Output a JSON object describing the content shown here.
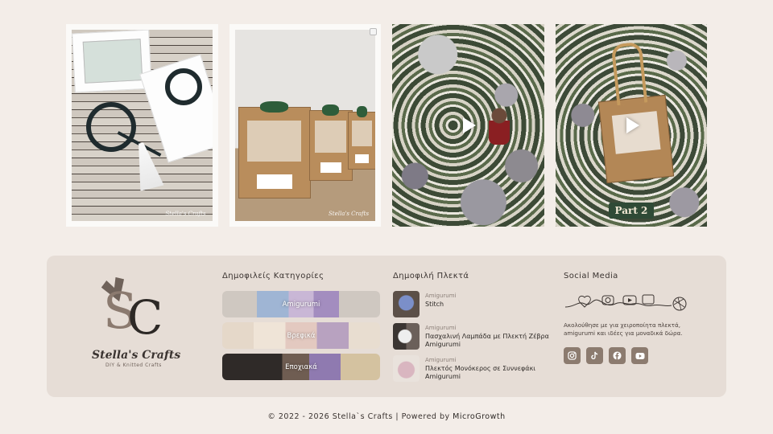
{
  "instagram": {
    "posts": [
      {
        "type": "image",
        "watermark": "Stella's Crafts"
      },
      {
        "type": "carousel",
        "watermark": "Stella's Crafts"
      },
      {
        "type": "video"
      },
      {
        "type": "video",
        "overlay_text": "Part 2"
      }
    ]
  },
  "brand": {
    "name": "Stella's Crafts",
    "tagline": "DIY & Knitted Crafts",
    "monogram_first": "S",
    "monogram_second": "C"
  },
  "categories": {
    "title": "Δημοφιλείς Κατηγορίες",
    "items": [
      {
        "label": "Amigurumi"
      },
      {
        "label": "Βρεφικά"
      },
      {
        "label": "Εποχιακά"
      }
    ]
  },
  "products": {
    "title": "Δημοφιλή Πλεκτά",
    "items": [
      {
        "category": "Amigurumi",
        "name": "Stitch"
      },
      {
        "category": "Amigurumi",
        "name": "Πασχαλινή Λαμπάδα με Πλεκτή Ζέβρα Amigurumi"
      },
      {
        "category": "Amigurumi",
        "name": "Πλεκτός Μονόκερος σε Συννεφάκι Amigurumi"
      }
    ]
  },
  "social": {
    "title": "Social Media",
    "text": "Ακολούθησε με για χειροποίητα πλεκτά, amigurumi και ιδέες για μοναδικά δώρα.",
    "icons": [
      "instagram-icon",
      "tiktok-icon",
      "facebook-icon",
      "youtube-icon"
    ]
  },
  "footer": {
    "copyright": "© 2022 - 2026 Stella`s Crafts | Powered by",
    "powered_by": "MicroGrowth"
  },
  "colors": {
    "background": "#f3ede8",
    "card": "#e6ddd6",
    "social_button": "#8c7b6f",
    "text": "#3a3330"
  }
}
